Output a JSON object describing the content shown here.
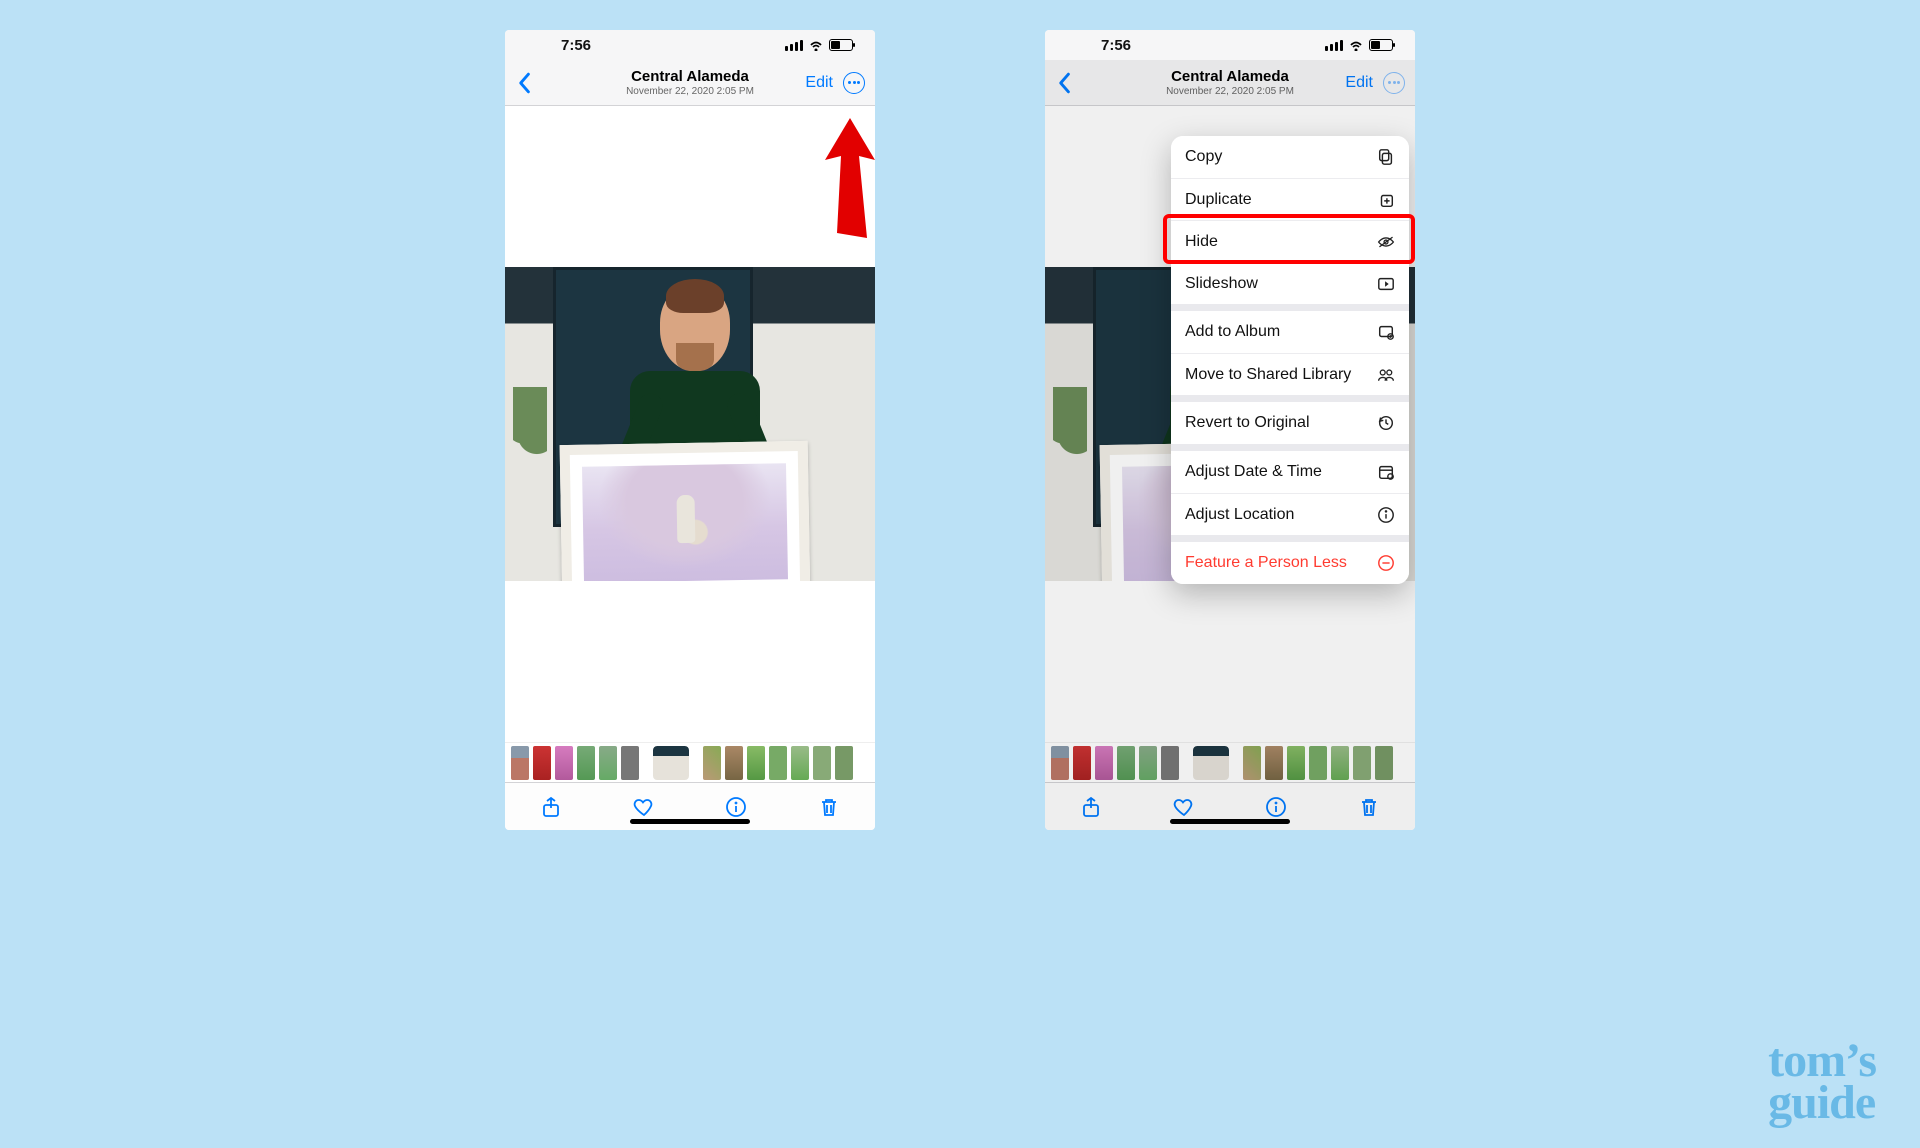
{
  "status": {
    "time": "7:56"
  },
  "header": {
    "title": "Central Alameda",
    "subtitle": "November 22, 2020  2:05 PM",
    "edit": "Edit"
  },
  "menu": {
    "copy": "Copy",
    "duplicate": "Duplicate",
    "hide": "Hide",
    "slideshow": "Slideshow",
    "add_album": "Add to Album",
    "move_shared": "Move to Shared Library",
    "revert": "Revert to Original",
    "adjust_datetime": "Adjust Date & Time",
    "adjust_location": "Adjust Location",
    "feature_less": "Feature a Person Less"
  },
  "watermark": {
    "line1": "tom’s",
    "line2": "guide"
  }
}
